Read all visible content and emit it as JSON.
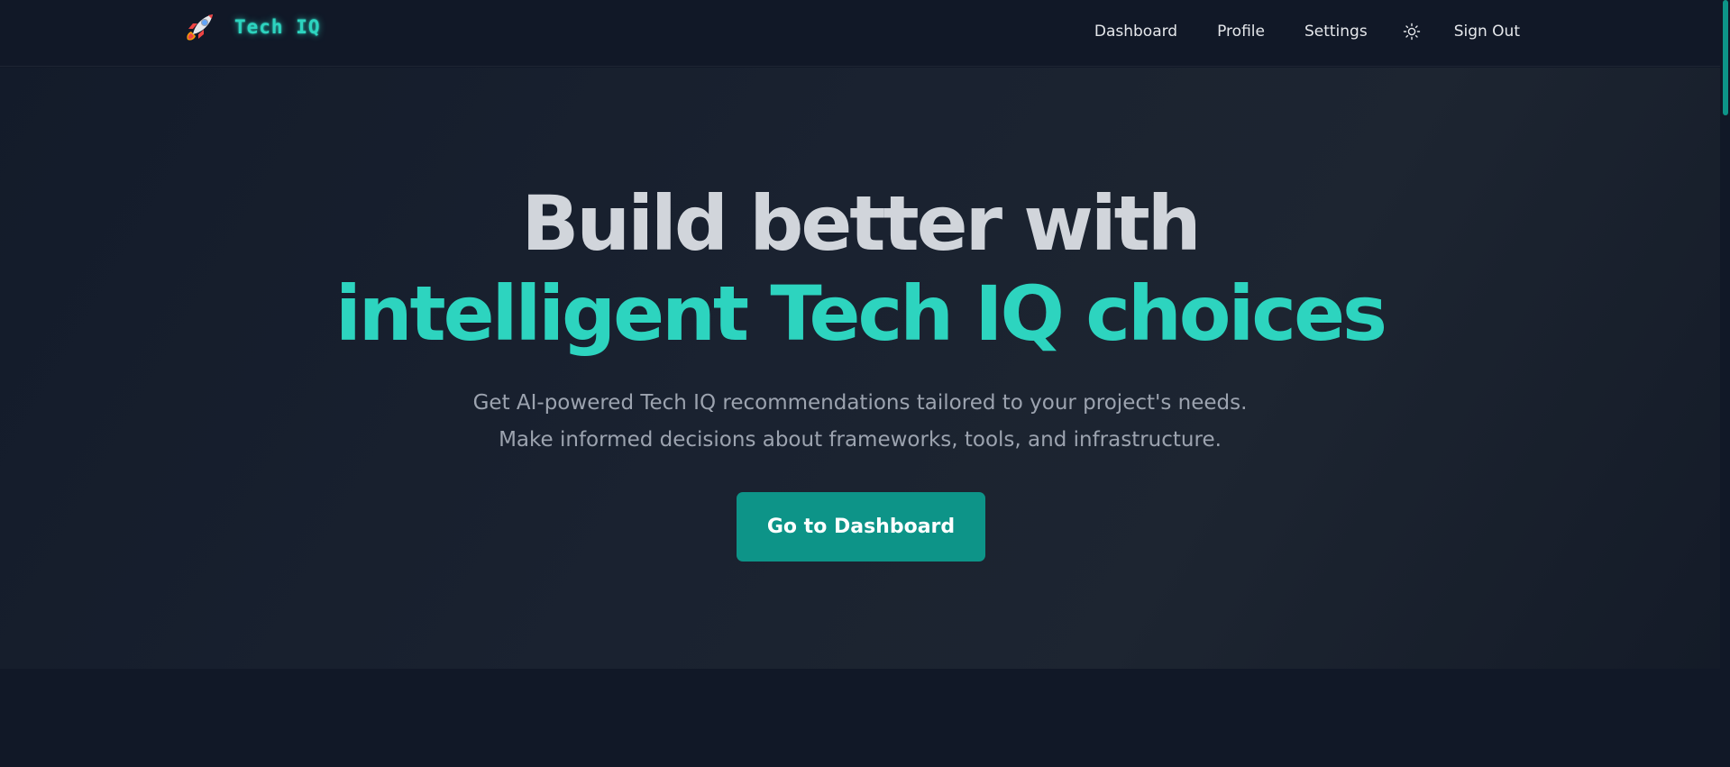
{
  "header": {
    "brand_name": "Tech IQ",
    "brand_icon": "rocket-icon",
    "nav": {
      "dashboard": "Dashboard",
      "profile": "Profile",
      "settings": "Settings",
      "theme_icon": "sun-icon",
      "sign_out": "Sign Out"
    }
  },
  "hero": {
    "headline_line1": "Build better with",
    "headline_line2": "intelligent Tech IQ choices",
    "subtitle": "Get AI-powered Tech IQ recommendations tailored to your project's needs. Make informed decisions about frameworks, tools, and infrastructure.",
    "cta_label": "Go to Dashboard"
  },
  "colors": {
    "background": "#111827",
    "accent": "#2dd4bf",
    "button": "#0d9488",
    "headline": "#d1d5db",
    "subtitle": "#9ca3af"
  }
}
